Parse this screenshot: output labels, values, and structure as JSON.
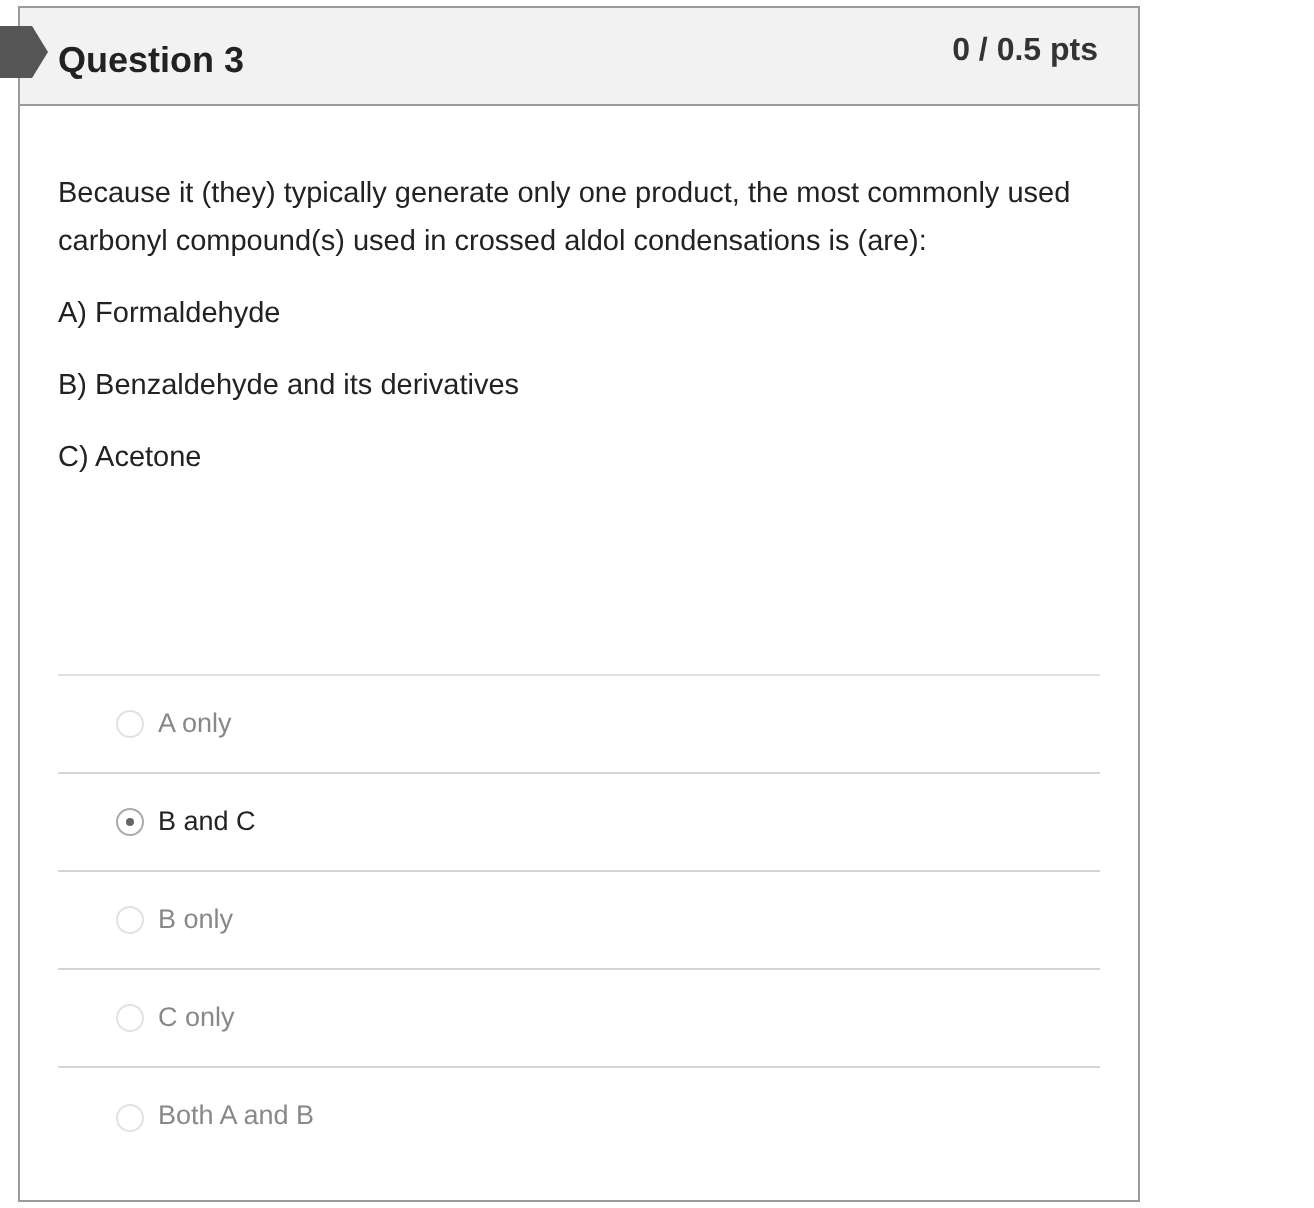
{
  "question": {
    "title": "Question 3",
    "score": "0 / 0.5 pts"
  },
  "prompt": "Because it (they) typically generate only one product, the most commonly used carbonyl compound(s) used in crossed aldol condensations is (are):",
  "statements": [
    "A) Formaldehyde",
    "B) Benzaldehyde and its derivatives",
    "C) Acetone"
  ],
  "answers": [
    {
      "label": "A only",
      "selected": false
    },
    {
      "label": "B and C",
      "selected": true
    },
    {
      "label": "B only",
      "selected": false
    },
    {
      "label": "C only",
      "selected": false
    },
    {
      "label": "Both A and B",
      "selected": false
    }
  ]
}
